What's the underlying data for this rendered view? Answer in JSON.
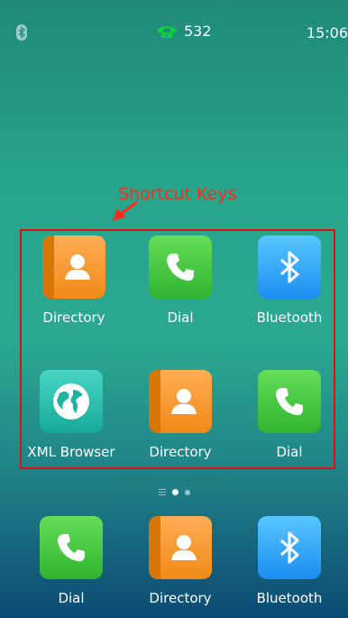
{
  "status": {
    "line_number": "532",
    "time": "15:06"
  },
  "annotation": {
    "label": "Shortcut Keys"
  },
  "pages": {
    "count": 2,
    "current": 1
  },
  "shortcuts": [
    {
      "label": "Directory",
      "icon": "directory-icon"
    },
    {
      "label": "Dial",
      "icon": "dial-icon"
    },
    {
      "label": "Bluetooth",
      "icon": "bluetooth-icon"
    },
    {
      "label": "XML Browser",
      "icon": "globe-icon"
    },
    {
      "label": "Directory",
      "icon": "directory-icon"
    },
    {
      "label": "Dial",
      "icon": "dial-icon"
    }
  ],
  "dock": [
    {
      "label": "Dial",
      "icon": "dial-icon"
    },
    {
      "label": "Directory",
      "icon": "directory-icon"
    },
    {
      "label": "Bluetooth",
      "icon": "bluetooth-icon"
    }
  ]
}
